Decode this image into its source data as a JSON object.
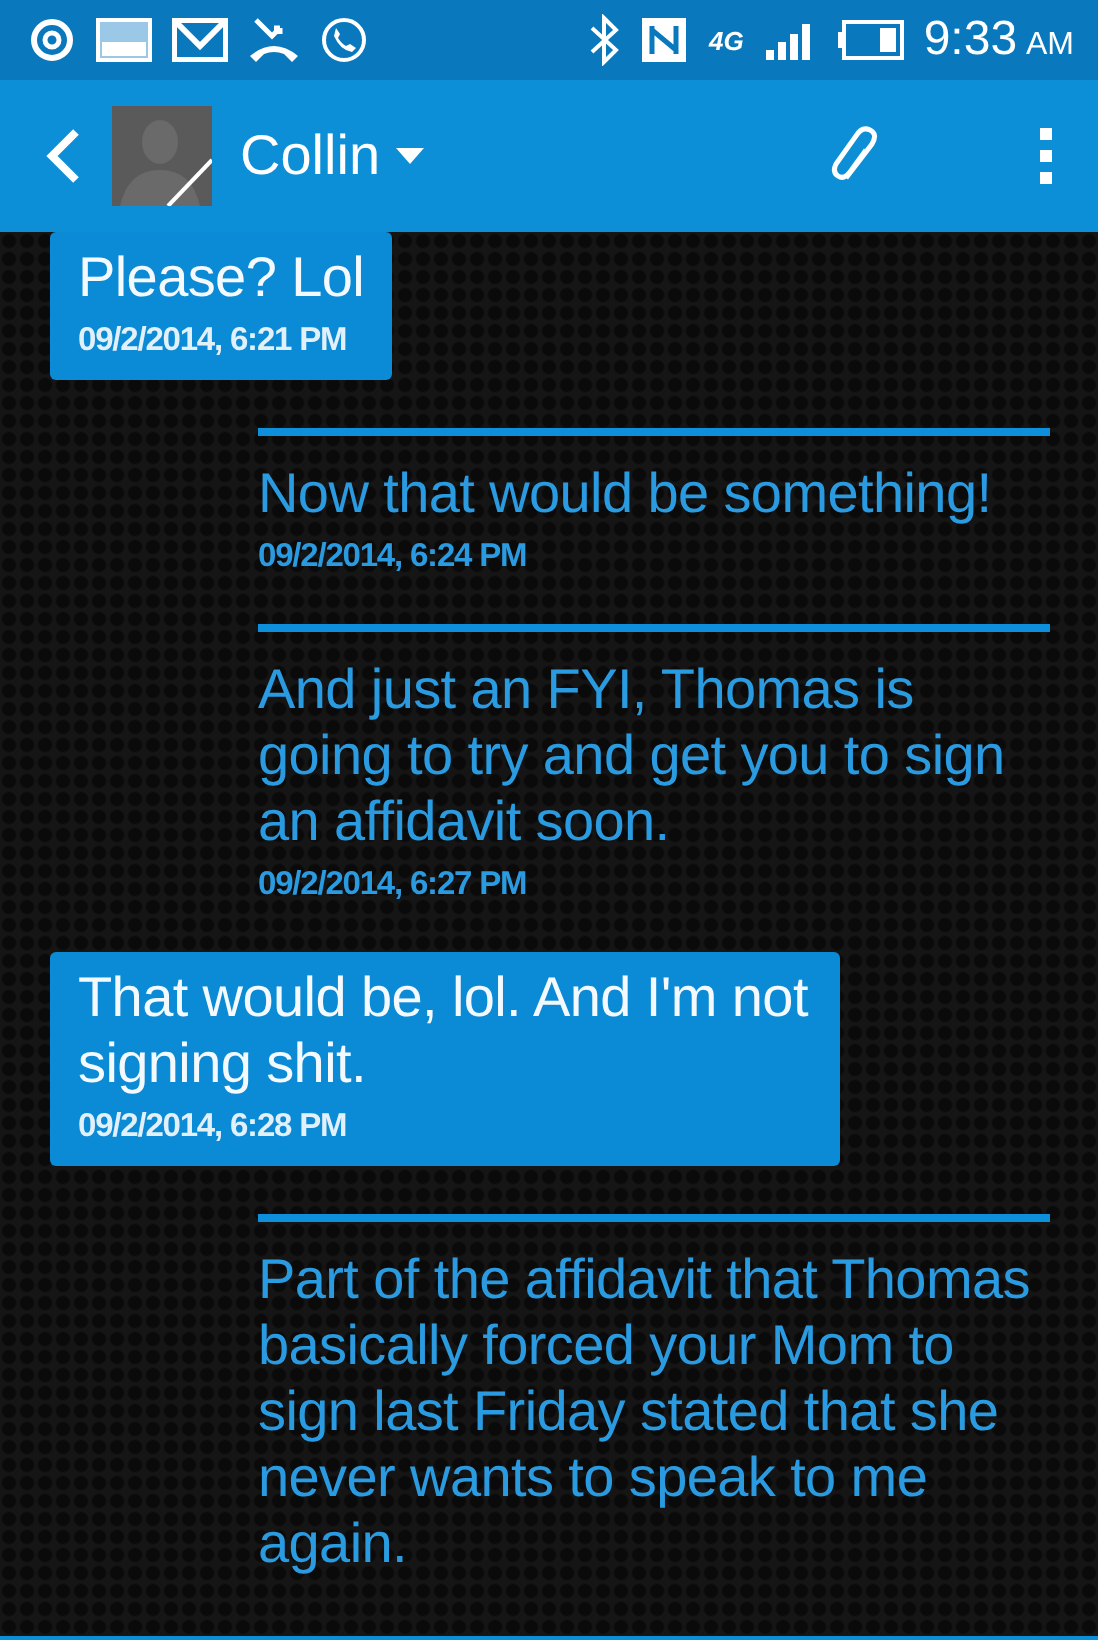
{
  "status_bar": {
    "time": "9:33",
    "meridiem": "AM",
    "network": "4G"
  },
  "header": {
    "contact": "Collin"
  },
  "messages": [
    {
      "kind": "received",
      "text": "Please? Lol",
      "time": "09/2/2014, 6:21 PM"
    },
    {
      "kind": "sent",
      "text": "Now that would be something!",
      "time": "09/2/2014, 6:24 PM"
    },
    {
      "kind": "sent",
      "text": "And just an FYI, Thomas is going to try and get you to sign an affidavit soon.",
      "time": "09/2/2014, 6:27 PM"
    },
    {
      "kind": "received",
      "text": "That would be, lol. And I'm not signing shit.",
      "time": "09/2/2014, 6:28 PM"
    },
    {
      "kind": "sent",
      "text": "Part of the affidavit that Thomas basically forced your Mom to sign last Friday stated that she never wants to speak to me again."
    }
  ]
}
